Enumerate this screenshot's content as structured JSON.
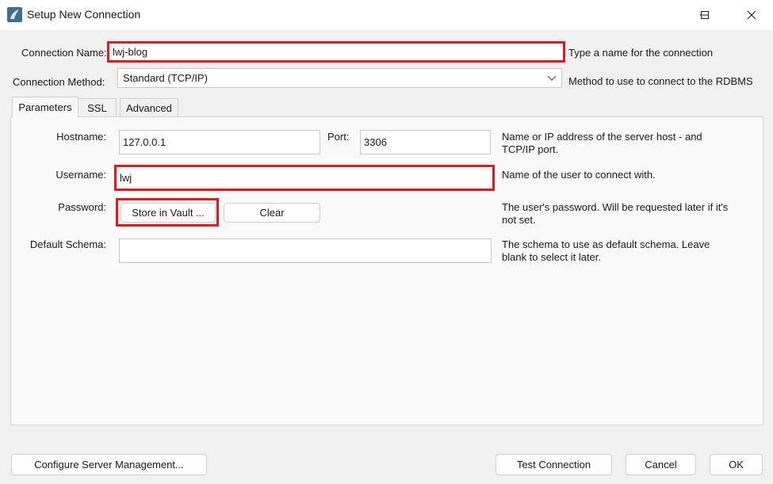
{
  "window": {
    "title": "Setup New Connection",
    "icons": {
      "app": "mysql-workbench-icon",
      "minimize": "minimize-icon",
      "maximize": "maximize-icon",
      "close": "close-icon"
    }
  },
  "connection": {
    "name_label": "Connection Name:",
    "name_value": "lwj-blog",
    "name_hint": "Type a name for the connection",
    "method_label": "Connection Method:",
    "method_value": "Standard (TCP/IP)",
    "method_hint": "Method to use to connect to the RDBMS"
  },
  "tabs": [
    "Parameters",
    "SSL",
    "Advanced"
  ],
  "parameters": {
    "hostname_label": "Hostname:",
    "hostname_value": "127.0.0.1",
    "port_label": "Port:",
    "port_value": "3306",
    "hostname_hint_1": "Name or IP address of the server host - and",
    "hostname_hint_2": "TCP/IP port.",
    "username_label": "Username:",
    "username_value": "lwj",
    "username_hint": "Name of the user to connect with.",
    "password_label": "Password:",
    "store_vault_label": "Store in Vault ...",
    "clear_label": "Clear",
    "password_hint_1": "The user's password. Will be requested later if it's",
    "password_hint_2": "not set.",
    "schema_label": "Default Schema:",
    "schema_value": "",
    "schema_hint_1": "The schema to use as default schema. Leave",
    "schema_hint_2": "blank to select it later."
  },
  "footer": {
    "configure_label": "Configure Server Management...",
    "test_label": "Test Connection",
    "cancel_label": "Cancel",
    "ok_label": "OK"
  },
  "colors": {
    "highlight": "#e11a22",
    "window_bg": "#f0f0f0"
  }
}
